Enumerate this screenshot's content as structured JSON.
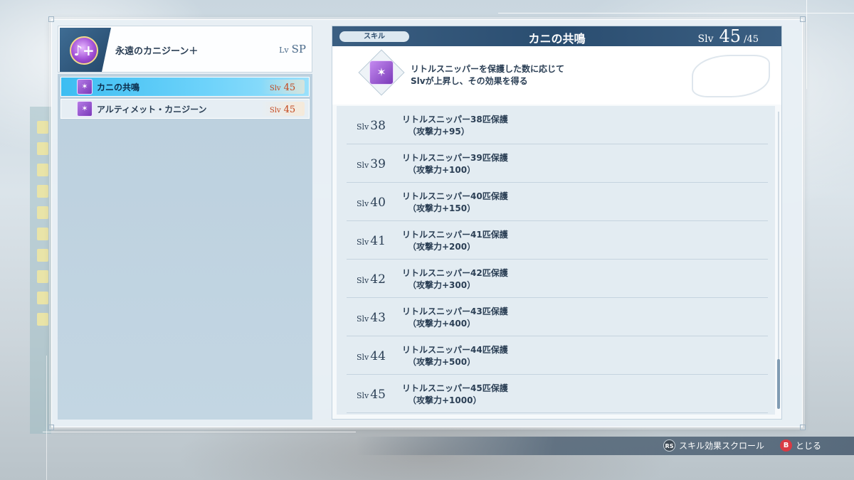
{
  "character": {
    "name": "永遠のカニジーン＋",
    "level_label": "Lv",
    "level_value": "SP",
    "emblem_glyph": "♪+",
    "emblem_icon": "star-emblem-icon"
  },
  "skills": [
    {
      "name": "カニの共鳴",
      "slv_label": "Slv",
      "slv_value": "45",
      "selected": true,
      "icon": "crab-icon"
    },
    {
      "name": "アルティメット・カニジーン",
      "slv_label": "Slv",
      "slv_value": "45",
      "selected": false,
      "icon": "crab-icon"
    }
  ],
  "detail": {
    "tag": "スキル",
    "title": "カニの共鳴",
    "slv_label": "Slv",
    "slv_current": "45",
    "slv_separator": "/",
    "slv_max": "45",
    "description_line1": "リトルスニッパーを保護した数に応じて",
    "description_line2": "Slvが上昇し、その効果を得る",
    "icon": "crab-icon"
  },
  "levels": [
    {
      "label": "Slv",
      "value": "38",
      "title": "リトルスニッパー38匹保護",
      "effect": "（攻撃力+95）"
    },
    {
      "label": "Slv",
      "value": "39",
      "title": "リトルスニッパー39匹保護",
      "effect": "（攻撃力+100）"
    },
    {
      "label": "Slv",
      "value": "40",
      "title": "リトルスニッパー40匹保護",
      "effect": "（攻撃力+150）"
    },
    {
      "label": "Slv",
      "value": "41",
      "title": "リトルスニッパー41匹保護",
      "effect": "（攻撃力+200）"
    },
    {
      "label": "Slv",
      "value": "42",
      "title": "リトルスニッパー42匹保護",
      "effect": "（攻撃力+300）"
    },
    {
      "label": "Slv",
      "value": "43",
      "title": "リトルスニッパー43匹保護",
      "effect": "（攻撃力+400）"
    },
    {
      "label": "Slv",
      "value": "44",
      "title": "リトルスニッパー44匹保護",
      "effect": "（攻撃力+500）"
    },
    {
      "label": "Slv",
      "value": "45",
      "title": "リトルスニッパー45匹保護",
      "effect": "（攻撃力+1000）"
    }
  ],
  "hints": {
    "scroll_button": "RS",
    "scroll_label": "スキル効果スクロール",
    "close_button": "B",
    "close_label": "とじる"
  },
  "colors": {
    "selected_row": "#3cbdf2",
    "header_bar": "#2a4d70",
    "slv_accent": "#c4451a"
  }
}
